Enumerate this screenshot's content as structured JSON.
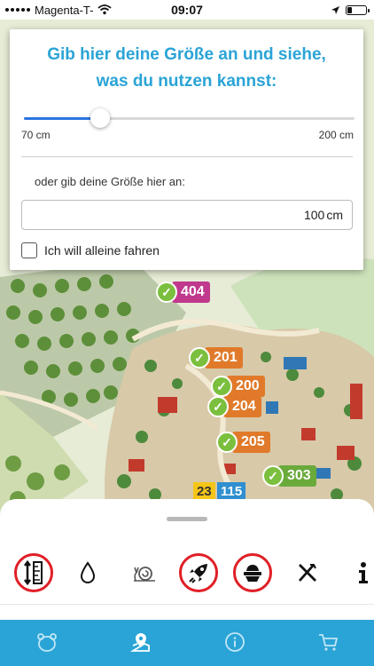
{
  "status_bar": {
    "carrier": "Magenta-T-",
    "time": "09:07",
    "battery_level": 0.25
  },
  "height_panel": {
    "title_line1": "Gib hier deine Größe an und siehe,",
    "title_line2": "was du nutzen kannst:",
    "slider_value_fraction": 0.23,
    "range_min_label": "70 cm",
    "range_max_label": "200 cm",
    "alt_input_label": "oder gib deine Größe hier an:",
    "height_value": "100",
    "height_unit": "cm",
    "alone_checkbox_label": "Ich will alleine fahren",
    "alone_checked": false
  },
  "map_markers": [
    {
      "number": "404",
      "color": "magenta"
    },
    {
      "number": "201",
      "color": "orange"
    },
    {
      "number": "200",
      "color": "orange"
    },
    {
      "number": "204",
      "color": "orange"
    },
    {
      "number": "205",
      "color": "orange"
    },
    {
      "number": "303",
      "color": "green"
    }
  ],
  "map_tags": [
    {
      "number": "23",
      "background": "#f5c518"
    },
    {
      "number": "115",
      "background": "#2f8fd0"
    }
  ],
  "filters": [
    {
      "icon": "height-ruler-icon",
      "active": true
    },
    {
      "icon": "water-drop-icon",
      "active": false
    },
    {
      "icon": "snail-icon",
      "active": false
    },
    {
      "icon": "rocket-icon",
      "active": true
    },
    {
      "icon": "food-bowl-icon",
      "active": true
    },
    {
      "icon": "fork-knife-icon",
      "active": false
    },
    {
      "icon": "info-icon",
      "active": false
    }
  ],
  "tabs": [
    {
      "icon": "bear-icon"
    },
    {
      "icon": "map-pin-icon",
      "selected": true
    },
    {
      "icon": "info-circle-icon"
    },
    {
      "icon": "cart-icon"
    }
  ],
  "colors": {
    "accent": "#2aa4d6",
    "slider_fill": "#2b75e0",
    "active_filter_ring": "#e01f26",
    "check_green": "#7bbf3e"
  }
}
